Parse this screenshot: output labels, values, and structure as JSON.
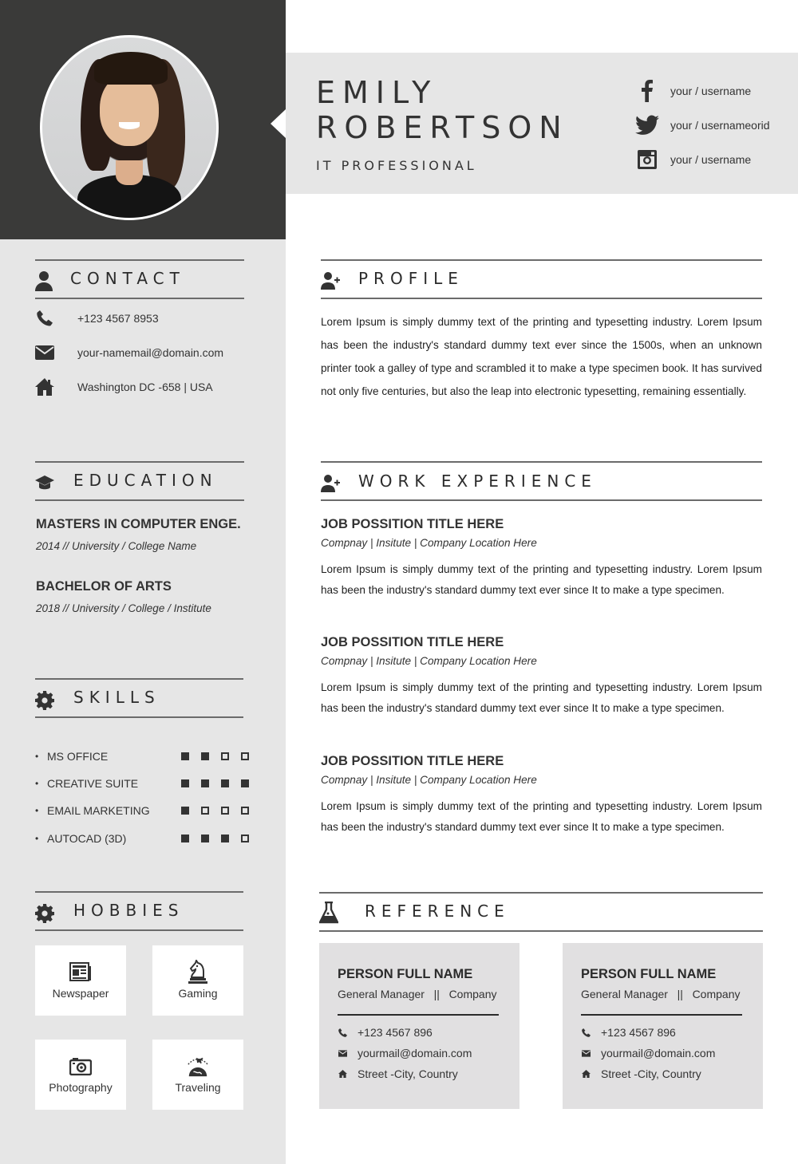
{
  "header": {
    "first_name": "EMILY",
    "last_name": "ROBERTSON",
    "role": "IT PROFESSIONAL",
    "socials": [
      {
        "icon": "facebook-icon",
        "text": "your / username"
      },
      {
        "icon": "twitter-icon",
        "text": "your / usernameorid"
      },
      {
        "icon": "instagram-icon",
        "text": "your / username"
      }
    ]
  },
  "sidebar": {
    "contact": {
      "title": "CONTACT",
      "icon": "user-icon",
      "items": [
        {
          "icon": "phone-icon",
          "text": "+123 4567 8953"
        },
        {
          "icon": "envelope-icon",
          "text": "your-namemail@domain.com"
        },
        {
          "icon": "home-icon",
          "text": "Washington DC -658 | USA"
        }
      ]
    },
    "education": {
      "title": "EDUCATION",
      "icon": "graduation-cap-icon",
      "items": [
        {
          "degree": "MASTERS IN COMPUTER ENGE.",
          "detail": "2014 // University / College Name"
        },
        {
          "degree": "BACHELOR OF ARTS",
          "detail": "2018 // University / College / Institute"
        }
      ]
    },
    "skills": {
      "title": "SKILLS",
      "icon": "gear-icon",
      "max_level": 4,
      "items": [
        {
          "name": "MS OFFICE",
          "level": 2
        },
        {
          "name": "CREATIVE SUITE",
          "level": 4
        },
        {
          "name": "EMAIL MARKETING",
          "level": 1
        },
        {
          "name": "AUTOCAD (3D)",
          "level": 3
        }
      ]
    },
    "hobbies": {
      "title": "HOBBIES",
      "icon": "gear-icon",
      "items": [
        {
          "icon": "newspaper-icon",
          "label": "Newspaper"
        },
        {
          "icon": "chess-knight-icon",
          "label": "Gaming"
        },
        {
          "icon": "camera-icon",
          "label": "Photography"
        },
        {
          "icon": "travel-globe-plane-icon",
          "label": "Traveling"
        }
      ]
    }
  },
  "main": {
    "profile": {
      "title": "PROFILE",
      "icon": "user-plus-icon",
      "text": "Lorem Ipsum is simply dummy text of the printing and typesetting industry. Lorem Ipsum has been the industry's standard dummy text ever since the 1500s, when an unknown printer took a galley of type and scrambled it to make a type specimen book. It has survived not only five centuries, but also the leap into electronic typesetting, remaining essentially."
    },
    "work": {
      "title": "WORK EXPERIENCE",
      "icon": "user-plus-icon",
      "jobs": [
        {
          "title": "JOB POSSITION TITLE HERE",
          "subtitle": "Compnay | Insitute | Company Location Here",
          "description": "Lorem Ipsum is simply dummy text of the printing and typesetting industry. Lorem Ipsum has been the industry's standard dummy text ever since It to make a type specimen."
        },
        {
          "title": "JOB POSSITION TITLE HERE",
          "subtitle": "Compnay | Insitute | Company Location Here",
          "description": "Lorem Ipsum is simply dummy text of the printing and typesetting industry. Lorem Ipsum has been the industry's standard dummy text ever since It to make a type specimen."
        },
        {
          "title": "JOB POSSITION TITLE HERE",
          "subtitle": "Compnay | Insitute | Company Location Here",
          "description": "Lorem Ipsum is simply dummy text of the printing and typesetting industry. Lorem Ipsum has been the industry's standard dummy text ever since It to make a type specimen."
        }
      ]
    },
    "reference": {
      "title": "REFERENCE",
      "icon": "flask-icon",
      "people": [
        {
          "name": "PERSON FULL NAME",
          "role": "General Manager   ||   Company",
          "phone": "+123 4567 896",
          "email": "yourmail@domain.com",
          "address": "Street -City, Country"
        },
        {
          "name": "PERSON FULL NAME",
          "role": "General Manager   ||   Company",
          "phone": "+123 4567 896",
          "email": "yourmail@domain.com",
          "address": "Street -City, Country"
        }
      ]
    }
  },
  "colors": {
    "dark": "#3a3a39",
    "panel": "#e6e6e6",
    "card": "#e1e0e1",
    "text": "#333333",
    "rule": "#6b6b6b"
  }
}
